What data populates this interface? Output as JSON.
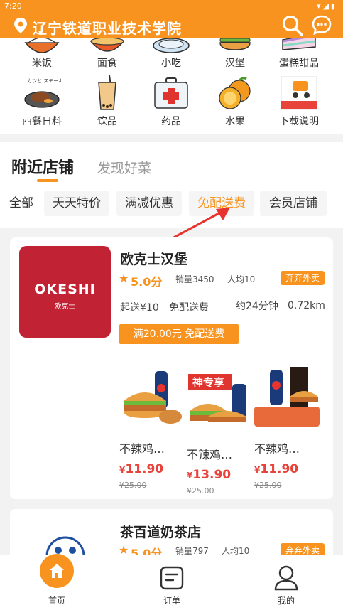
{
  "status_bar": {
    "time": "7:20",
    "icons": "▾◢▮"
  },
  "header": {
    "school_name": "辽宁铁道职业技术学院"
  },
  "categories": [
    {
      "label": "米饭",
      "icon": "rice-bowl-icon"
    },
    {
      "label": "面食",
      "icon": "noodle-bowl-icon"
    },
    {
      "label": "小吃",
      "icon": "snack-plate-icon"
    },
    {
      "label": "汉堡",
      "icon": "burger-icon"
    },
    {
      "label": "蛋糕甜品",
      "icon": "cake-icon"
    },
    {
      "label": "西餐日料",
      "icon": "steak-icon"
    },
    {
      "label": "饮品",
      "icon": "bubble-tea-icon"
    },
    {
      "label": "药品",
      "icon": "medical-kit-icon"
    },
    {
      "label": "水果",
      "icon": "orange-fruit-icon"
    },
    {
      "label": "下载说明",
      "icon": "delivery-scooter-icon"
    }
  ],
  "tabs": {
    "nearby": "附近店铺",
    "discover": "发现好菜"
  },
  "filters": [
    "全部",
    "天天特价",
    "满减优惠",
    "免配送费",
    "会员店铺"
  ],
  "shops": [
    {
      "name": "欧克士汉堡",
      "logo_text": "OKESHI",
      "logo_sub": "欧克士",
      "rating": "5.0分",
      "sales": "销量3450",
      "avg": "人均10",
      "tag": "弃弃外卖",
      "min_order": "起送¥10",
      "delivery": "免配送费",
      "time": "约24分钟",
      "distance": "0.72km",
      "promo": "满20.00元 免配送费",
      "dishes": [
        {
          "name": "不辣鸡…",
          "price_symbol": "¥",
          "price": "11.90",
          "old_price": "¥25.00"
        },
        {
          "name": "不辣鸡…",
          "price_symbol": "¥",
          "price": "13.90",
          "old_price": "¥25.00"
        },
        {
          "name": "不辣鸡…",
          "price_symbol": "¥",
          "price": "11.90",
          "old_price": "¥25.00"
        }
      ]
    },
    {
      "name": "茶百道奶茶店",
      "rating": "5.0分",
      "sales": "销量797",
      "avg": "人均10",
      "tag": "弃弃外卖"
    }
  ],
  "dish_badge": "神专享",
  "nav": [
    {
      "label": "首页",
      "icon": "home-icon"
    },
    {
      "label": "订单",
      "icon": "order-icon"
    },
    {
      "label": "我的",
      "icon": "profile-icon"
    }
  ],
  "colors": {
    "brand": "#f7931e",
    "price": "#e8433a",
    "logo_red": "#c12234"
  }
}
